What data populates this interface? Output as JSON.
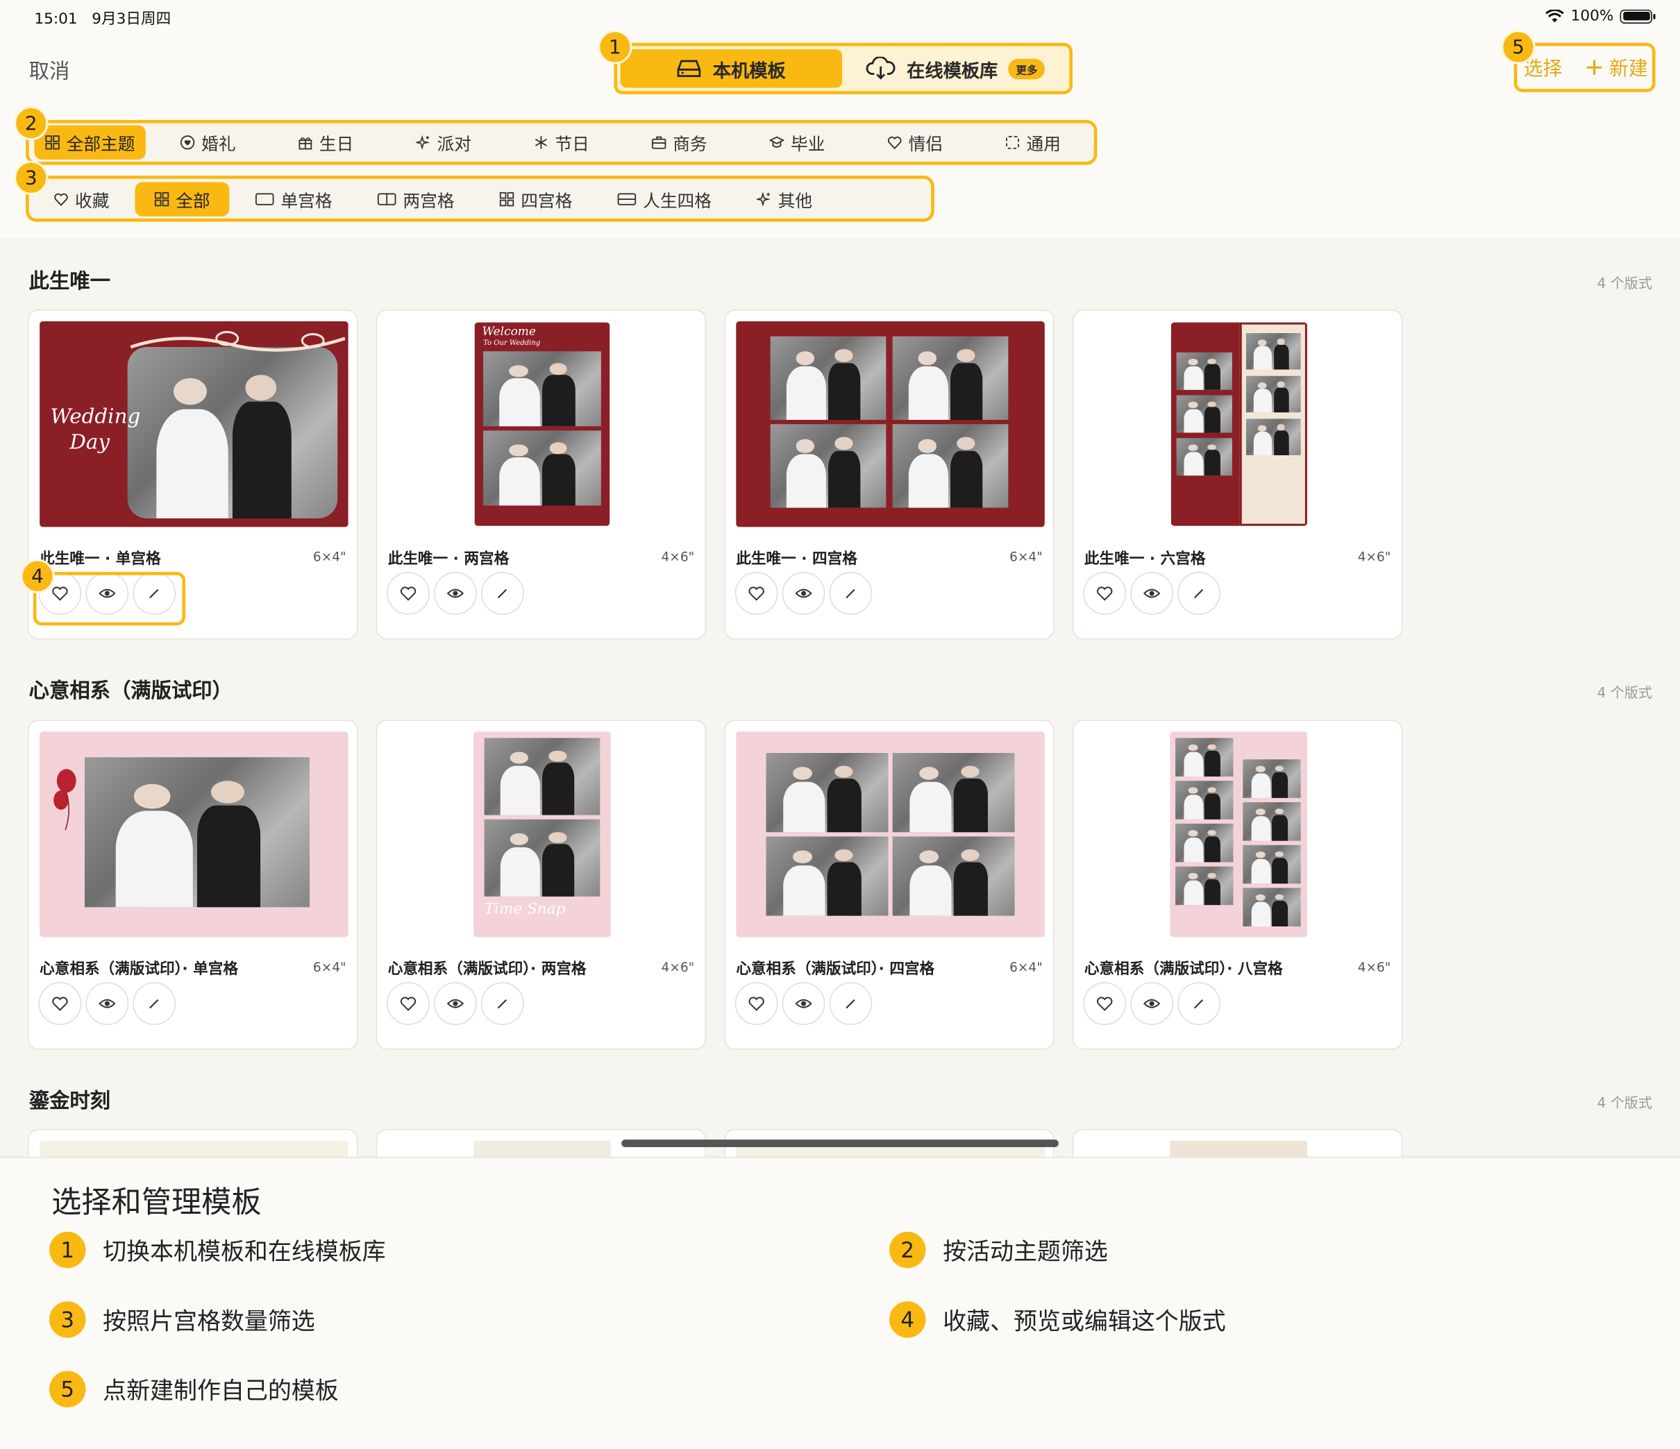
{
  "status": {
    "time": "15:01",
    "date": "9月3日周四",
    "battery": "100%"
  },
  "header": {
    "cancel": "取消",
    "segment": [
      {
        "label": "本机模板",
        "active": true
      },
      {
        "label": "在线模板库",
        "badge": "更多",
        "active": false
      }
    ],
    "select": "选择",
    "new": "新建"
  },
  "themes": [
    "全部主题",
    "婚礼",
    "生日",
    "派对",
    "节日",
    "商务",
    "毕业",
    "情侣",
    "通用"
  ],
  "layouts": [
    "收藏",
    "全部",
    "单宫格",
    "两宫格",
    "四宫格",
    "人生四格",
    "其他"
  ],
  "sections": [
    {
      "title": "此生唯一",
      "count": "4 个版式",
      "cards": [
        {
          "name": "此生唯一 · 单宫格",
          "size": "6×4\""
        },
        {
          "name": "此生唯一 · 两宫格",
          "size": "4×6\""
        },
        {
          "name": "此生唯一 · 四宫格",
          "size": "6×4\""
        },
        {
          "name": "此生唯一 · 六宫格",
          "size": "4×6\""
        }
      ]
    },
    {
      "title": "心意相系（满版试印）",
      "count": "4 个版式",
      "cards": [
        {
          "name": "心意相系（满版试印）· 单宫格",
          "size": "6×4\""
        },
        {
          "name": "心意相系（满版试印）· 两宫格",
          "size": "4×6\""
        },
        {
          "name": "心意相系（满版试印）· 四宫格",
          "size": "6×4\""
        },
        {
          "name": "心意相系（满版试印）· 八宫格",
          "size": "4×6\""
        }
      ]
    },
    {
      "title": "鎏金时刻",
      "count": "4 个版式"
    }
  ],
  "thumb_text": {
    "wedding_day_1": "Wedding",
    "wedding_day_2": "Day",
    "welcome": "Welcome",
    "welcome_2": "To Our Wedding",
    "time_snap": "Time  Snap"
  },
  "badges": [
    "1",
    "2",
    "3",
    "4",
    "5"
  ],
  "guide": {
    "title": "选择和管理模板",
    "items": [
      {
        "num": "1",
        "text": "切换本机模板和在线模板库"
      },
      {
        "num": "2",
        "text": "按活动主题筛选"
      },
      {
        "num": "3",
        "text": "按照片宫格数量筛选"
      },
      {
        "num": "4",
        "text": "收藏、预览或编辑这个版式"
      },
      {
        "num": "5",
        "text": "点新建制作自己的模板"
      }
    ]
  },
  "colors": {
    "accent": "#f9b912",
    "wine": "#8b1f26",
    "pink": "#f4d3d8",
    "card_border": "#e6e2da"
  }
}
